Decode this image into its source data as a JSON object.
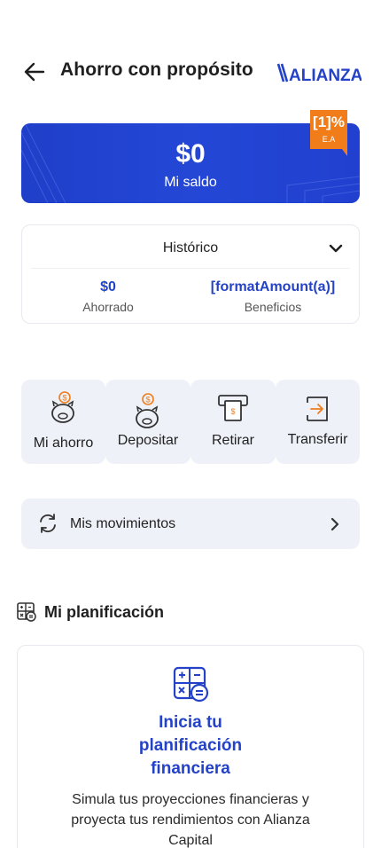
{
  "header": {
    "title": "Ahorro con propósito",
    "logo_text": "ALIANZA"
  },
  "balance": {
    "amount": "$0",
    "label": "Mi saldo",
    "rate_value": "[1]%",
    "rate_unit": "E.A"
  },
  "history": {
    "title": "Histórico",
    "saved_value": "$0",
    "saved_label": "Ahorrado",
    "benefits_value": "[formatAmount(a)]",
    "benefits_label": "Beneficios"
  },
  "actions": [
    {
      "label": "Mi ahorro",
      "icon": "piggy-bank-coin-icon"
    },
    {
      "label": "Depositar",
      "icon": "piggy-bank-deposit-icon"
    },
    {
      "label": "Retirar",
      "icon": "atm-withdraw-icon"
    },
    {
      "label": "Transferir",
      "icon": "transfer-arrow-icon"
    }
  ],
  "movements": {
    "label": "Mis movimientos"
  },
  "planning": {
    "section_title": "Mi planificación",
    "card_heading_lines": [
      "Inicia tu",
      "planificación",
      "financiera"
    ],
    "card_description_lines": [
      "Simula tus proyecciones financieras y",
      "proyecta tus rendimientos con Alianza",
      "Capital"
    ]
  },
  "colors": {
    "primary_blue": "#2442c8",
    "accent_orange": "#f07c1a",
    "action_bg": "#eef1f8"
  }
}
